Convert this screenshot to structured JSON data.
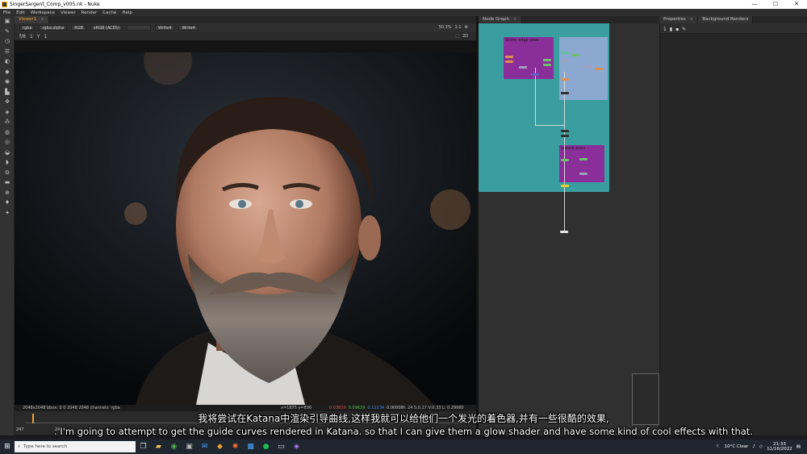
{
  "window": {
    "title": "SingerSargent_Comp_v005.nk - Nuke",
    "controls": [
      "—",
      "☐",
      "✕"
    ]
  },
  "menu": [
    "File",
    "Edit",
    "Workspace",
    "Viewer",
    "Render",
    "Cache",
    "Help"
  ],
  "viewer": {
    "tab": "Viewer1",
    "channels": "rgba",
    "alpha": "rgba.alpha",
    "colorspace": "RGB",
    "display": "sRGB (ACES)",
    "input_a": "Write4",
    "input_b": "Write4",
    "gain": "f/8",
    "gain_value": "1",
    "gamma_label": "Y",
    "gamma_value": "1",
    "zoom": "50.3%",
    "ratio": "1:1",
    "view_mode": "2D",
    "format": "2048x2048 bbox: 0 0 2048 2048 channels: rgba",
    "pixel": "x=1875 y=836",
    "rgba_r": "0.03819",
    "rgba_g": "0.09629",
    "rgba_b": "0.12134",
    "rgba_a": "0.00000",
    "hsv": "H: 24 S:0.17 V:0.33  L: 0.29980",
    "frame": "247",
    "fps": "24*"
  },
  "node_graph": {
    "tab": "Node Graph",
    "backdrops": [
      "Shitty edge glow",
      "Isolate eyes"
    ]
  },
  "properties": {
    "tabs": [
      "Properties",
      "Background Renders"
    ],
    "count": "1"
  },
  "subtitles": {
    "zh": "我将尝试在Katana中渲染引导曲线,这样我就可以给他们一个发光的着色器,并有一些很酷的效果,",
    "en": ". I'm going to attempt to get the guide curves rendered in Katana. so that I can give them a glow shader and have some kind of cool effects with that."
  },
  "taskbar": {
    "search_placeholder": "Type here to search",
    "weather": "10°C  Clear",
    "time": "21:33",
    "date": "11/16/2022"
  }
}
